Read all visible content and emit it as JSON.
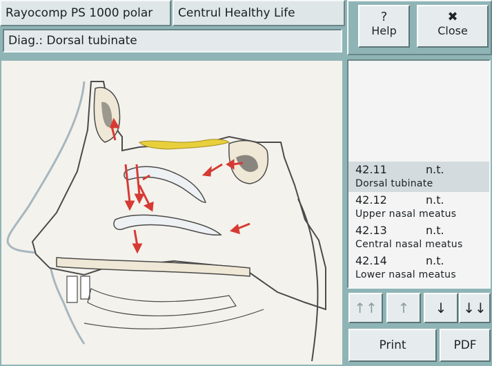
{
  "header": {
    "app_title": "Rayocomp PS 1000 polar",
    "center_name": "Centrul Healthy Life",
    "diagnosis": "Diag.: Dorsal tubinate"
  },
  "toolbar": {
    "help_icon": "?",
    "help_label": "Help",
    "close_icon": "✖",
    "close_label": "Close"
  },
  "results": {
    "items": [
      {
        "code": "42.11",
        "value": "n.t.",
        "name": "Dorsal tubinate",
        "selected": true
      },
      {
        "code": "42.12",
        "value": "n.t.",
        "name": "Upper nasal meatus",
        "selected": false
      },
      {
        "code": "42.13",
        "value": "n.t.",
        "name": "Central nasal meatus",
        "selected": false
      },
      {
        "code": "42.14",
        "value": "n.t.",
        "name": "Lower nasal meatus",
        "selected": false
      }
    ]
  },
  "navigation": {
    "first_glyph": "↑↑",
    "up_glyph": "↑",
    "down_glyph": "↓",
    "last_glyph": "↓↓"
  },
  "actions": {
    "print_label": "Print",
    "pdf_label": "PDF"
  },
  "illustration": {
    "subject": "nasal-cavity-sagittal-section",
    "colors": {
      "bone": "#efe8d6",
      "outline": "#4a4a4a",
      "arrow": "#d63a33",
      "highlight": "#e8cf3c",
      "skin": "#a7b6bf"
    }
  }
}
